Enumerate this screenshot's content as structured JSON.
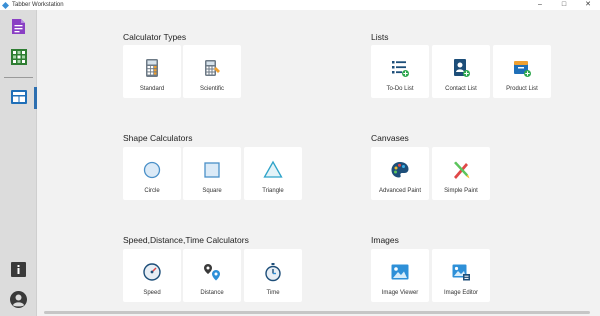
{
  "window": {
    "title": "Tabber Workstation",
    "controls": [
      "–",
      "□",
      "✕"
    ]
  },
  "sidebar": {
    "items": [
      {
        "name": "notes"
      },
      {
        "name": "spreadsheet"
      },
      {
        "name": "dashboard",
        "active": true
      },
      {
        "name": "info"
      },
      {
        "name": "user"
      }
    ]
  },
  "sections": {
    "calculator_types": {
      "title": "Calculator Types",
      "cards": [
        {
          "label": "Standard",
          "icon": "calculator-icon"
        },
        {
          "label": "Scientific",
          "icon": "scientific-calculator-icon"
        }
      ]
    },
    "lists": {
      "title": "Lists",
      "cards": [
        {
          "label": "To-Do List",
          "icon": "todo-list-icon"
        },
        {
          "label": "Contact List",
          "icon": "contact-list-icon"
        },
        {
          "label": "Product List",
          "icon": "product-list-icon"
        }
      ]
    },
    "shape_calculators": {
      "title": "Shape Calculators",
      "cards": [
        {
          "label": "Circle",
          "icon": "circle-icon"
        },
        {
          "label": "Square",
          "icon": "square-icon"
        },
        {
          "label": "Triangle",
          "icon": "triangle-icon"
        }
      ]
    },
    "canvases": {
      "title": "Canvases",
      "cards": [
        {
          "label": "Advanced Paint",
          "icon": "palette-icon"
        },
        {
          "label": "Simple Paint",
          "icon": "paint-tools-icon"
        }
      ]
    },
    "speed_calculators": {
      "title": "Speed,Distance,Time  Calculators",
      "cards": [
        {
          "label": "Speed",
          "icon": "speedometer-icon"
        },
        {
          "label": "Distance",
          "icon": "distance-pin-icon"
        },
        {
          "label": "Time",
          "icon": "stopwatch-icon"
        }
      ]
    },
    "images": {
      "title": "Images",
      "cards": [
        {
          "label": "Image Viewer",
          "icon": "image-viewer-icon"
        },
        {
          "label": "Image Editor",
          "icon": "image-editor-icon"
        }
      ]
    }
  },
  "colors": {
    "accent": "#2d6fb0",
    "sidebar": "#dcdcdc",
    "background": "#f2f2f2",
    "card": "#ffffff"
  }
}
